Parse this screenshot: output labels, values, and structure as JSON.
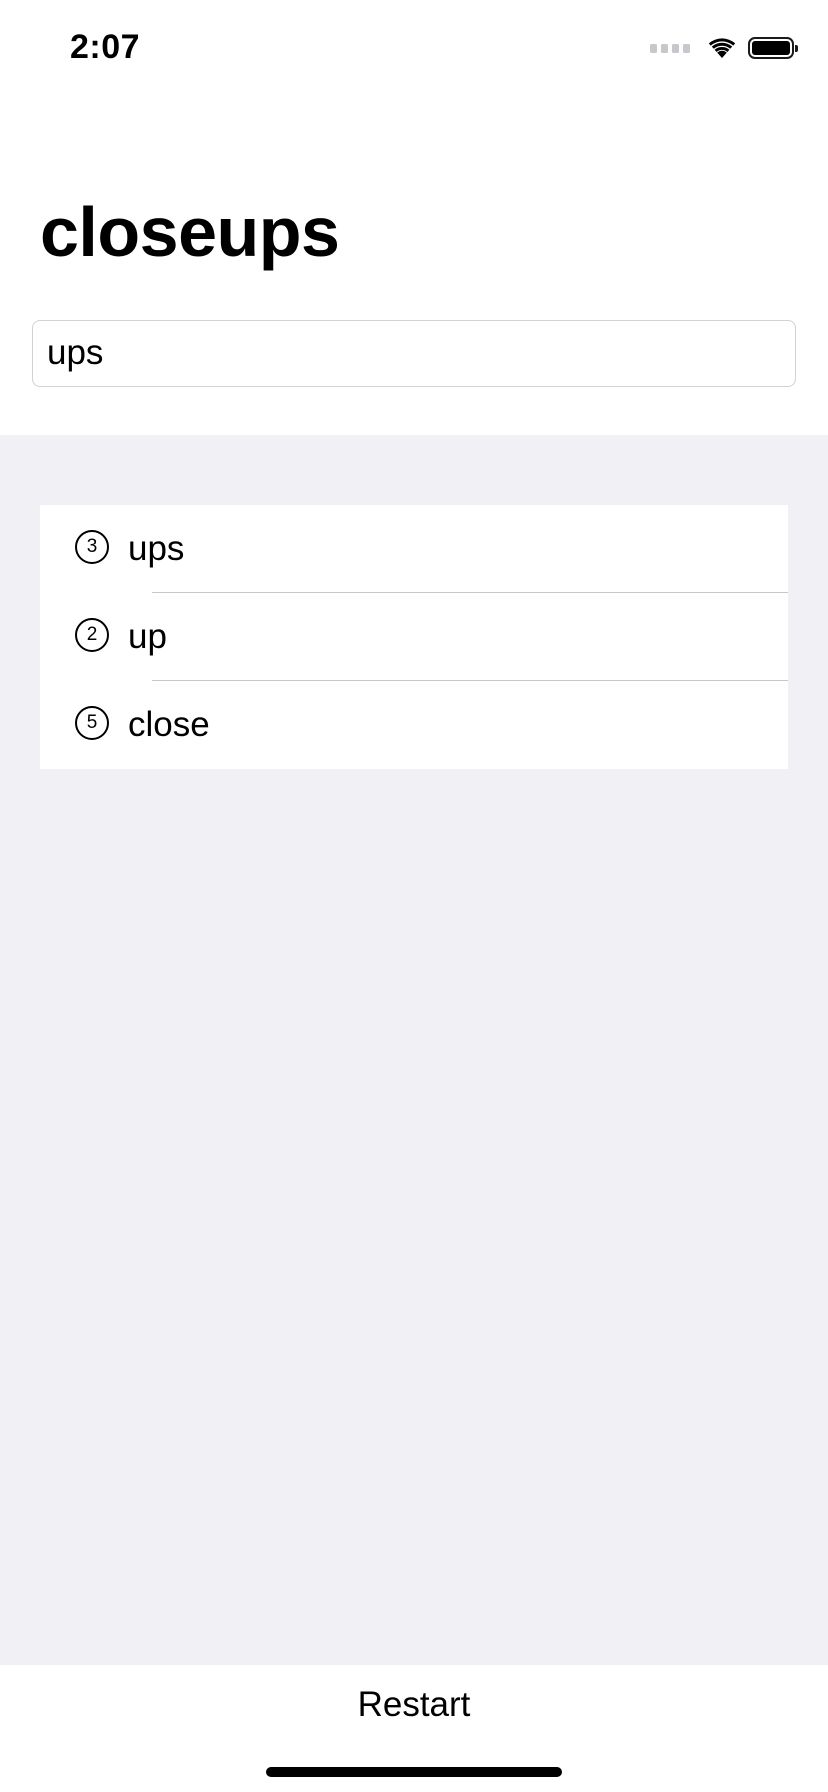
{
  "status_bar": {
    "time": "2:07",
    "icons": [
      "cellular-signal-icon",
      "wifi-icon",
      "battery-icon"
    ]
  },
  "header": {
    "title": "closeups"
  },
  "input": {
    "value": "ups"
  },
  "results": [
    {
      "count": "3",
      "word": "ups"
    },
    {
      "count": "2",
      "word": "up"
    },
    {
      "count": "5",
      "word": "close"
    }
  ],
  "footer": {
    "restart_label": "Restart"
  },
  "colors": {
    "background_gray": "#f1f0f5",
    "divider": "#c8c7cc",
    "field_border": "#d1d1d6"
  }
}
